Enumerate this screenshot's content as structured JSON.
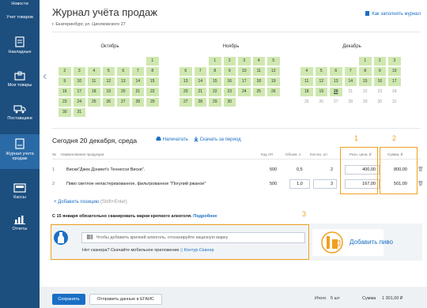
{
  "sidebar": {
    "items": [
      {
        "label": "Новости",
        "icon": "news-icon"
      },
      {
        "label": "Учет товаров",
        "icon": "goods-accounting-icon"
      },
      {
        "label": "Накладные",
        "icon": "invoice-icon"
      },
      {
        "label": "Мои товары",
        "icon": "box-icon"
      },
      {
        "label": "Поставщики",
        "icon": "truck-icon"
      },
      {
        "label": "Журнал учета продаж",
        "icon": "journal-icon"
      },
      {
        "label": "Кассы",
        "icon": "cash-register-icon"
      },
      {
        "label": "Отчеты",
        "icon": "chart-icon"
      }
    ]
  },
  "header": {
    "title": "Журнал учёта продаж",
    "address": "г. Екатеринбург, ул. Циолковского 27",
    "howto_link": "Как заполнять журнал"
  },
  "calendar": {
    "months": [
      {
        "name": "Октябрь",
        "weeks": [
          [
            "",
            "",
            "",
            "",
            "",
            "",
            "1"
          ],
          [
            "2",
            "3",
            "4",
            "5",
            "6",
            "7",
            "8"
          ],
          [
            "9",
            "10",
            "11",
            "12",
            "13",
            "14",
            "15"
          ],
          [
            "16",
            "17",
            "18",
            "19",
            "20",
            "21",
            "22"
          ],
          [
            "23",
            "24",
            "25",
            "26",
            "27",
            "28",
            "29"
          ],
          [
            "30",
            "31",
            "",
            "",
            "",
            "",
            ""
          ]
        ]
      },
      {
        "name": "Ноябрь",
        "weeks": [
          [
            "",
            "",
            "1",
            "2",
            "3",
            "4",
            "5"
          ],
          [
            "6",
            "7",
            "8",
            "9",
            "10",
            "11",
            "12"
          ],
          [
            "13",
            "14",
            "15",
            "16",
            "17",
            "18",
            "19"
          ],
          [
            "20",
            "21",
            "22",
            "23",
            "24",
            "25",
            "26"
          ],
          [
            "27",
            "28",
            "29",
            "30",
            "",
            "",
            ""
          ]
        ]
      },
      {
        "name": "Декабрь",
        "weeks": [
          [
            "",
            "",
            "",
            "",
            "1",
            "2",
            "3"
          ],
          [
            "4",
            "5",
            "6",
            "7",
            "8",
            "9",
            "10"
          ],
          [
            "11",
            "12",
            "13",
            "14",
            "15",
            "16",
            "17"
          ],
          [
            "18",
            "19",
            "20",
            "21",
            "22",
            "23",
            "24"
          ],
          [
            "25",
            "26",
            "27",
            "28",
            "29",
            "30",
            "31"
          ]
        ],
        "today": "20"
      }
    ]
  },
  "day": {
    "heading": "Сегодня 20 декабря, среда",
    "print_label": "Напечатать",
    "download_label": "Скачать за период"
  },
  "annotations": {
    "n1": "1",
    "n2": "2",
    "n3": "3"
  },
  "table": {
    "headers": [
      "№",
      "Наименование продукции",
      "Код АП",
      "Объем, л",
      "Кол-во, шт",
      "Розн. цена, ₽",
      "Сумма, ₽"
    ],
    "rows": [
      {
        "num": "1",
        "name": "Виски\"Джек Дэниел's Теннесси Виски\".",
        "code": "500",
        "volume": "0,5",
        "qty": "2",
        "price": "400,00",
        "sum": "800,00"
      },
      {
        "num": "2",
        "name": "Пиво светлое непастеризованное, фильтрованное \"Погулий ржаное\"",
        "code": "500",
        "volume": "1,0",
        "qty": "3",
        "price": "167,00",
        "sum": "501,00"
      }
    ],
    "add_label": "Добавить позицию",
    "add_hint": "(Shift+Enter)"
  },
  "notice": {
    "text": "С 15 января обязательно сканировать марки крепкого алкоголя.",
    "more": "Подробнее"
  },
  "scan": {
    "placeholder": "Чтобы добавить крепкий алкоголь, отсканируйте акцизную марку",
    "no_scanner": "Нет сканера? Скачайте мобильное приложение",
    "app_link": "Контур.Сканер",
    "add_beer": "Добавить пиво"
  },
  "footer": {
    "save": "Сохранить",
    "send": "Отправить данные в ЕГАИС",
    "total_label": "Итого",
    "total_count": "5 шт",
    "sum_label": "Сумма",
    "sum_value": "1 301,00 ₽"
  },
  "colors": {
    "accent": "#1a6fc4",
    "sidebar": "#1c4e7e",
    "highlight": "#f0a020",
    "calendar_filled": "#cfe8b0"
  }
}
